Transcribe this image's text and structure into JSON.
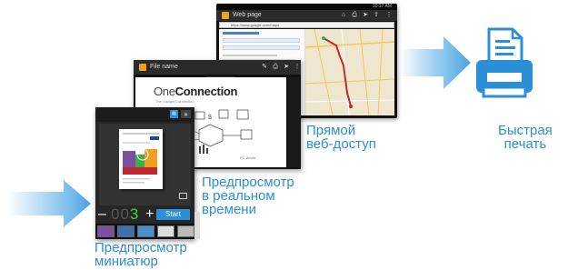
{
  "captions": {
    "thumbnail_preview": "Предпросмотр\nминиатюр",
    "realtime_preview": "Предпросмотр\nв реальном\nвремени",
    "direct_web_access": "Прямой\nвеб-доступ",
    "quick_print": "Быстрая\nпечать"
  },
  "web_screen": {
    "title": "Web page",
    "url": "https://www.google.com/maps",
    "time": "10:17 AM"
  },
  "file_screen": {
    "title": "File name",
    "brand_light": "One",
    "brand_bold": "Connection",
    "tagline": "The Gadget Connection",
    "footer": "PC World"
  },
  "print_screen": {
    "copies_dim": "00",
    "copies_value": "3",
    "minus": "–",
    "plus": "+",
    "start_label": "Start"
  },
  "colors": {
    "accent": "#2a8fd6",
    "counter_green": "#4ccd3a",
    "arrow_blue": "#5aaee6"
  },
  "icons": {
    "arrows": "chevron-arrow",
    "printer": "printer-icon"
  }
}
